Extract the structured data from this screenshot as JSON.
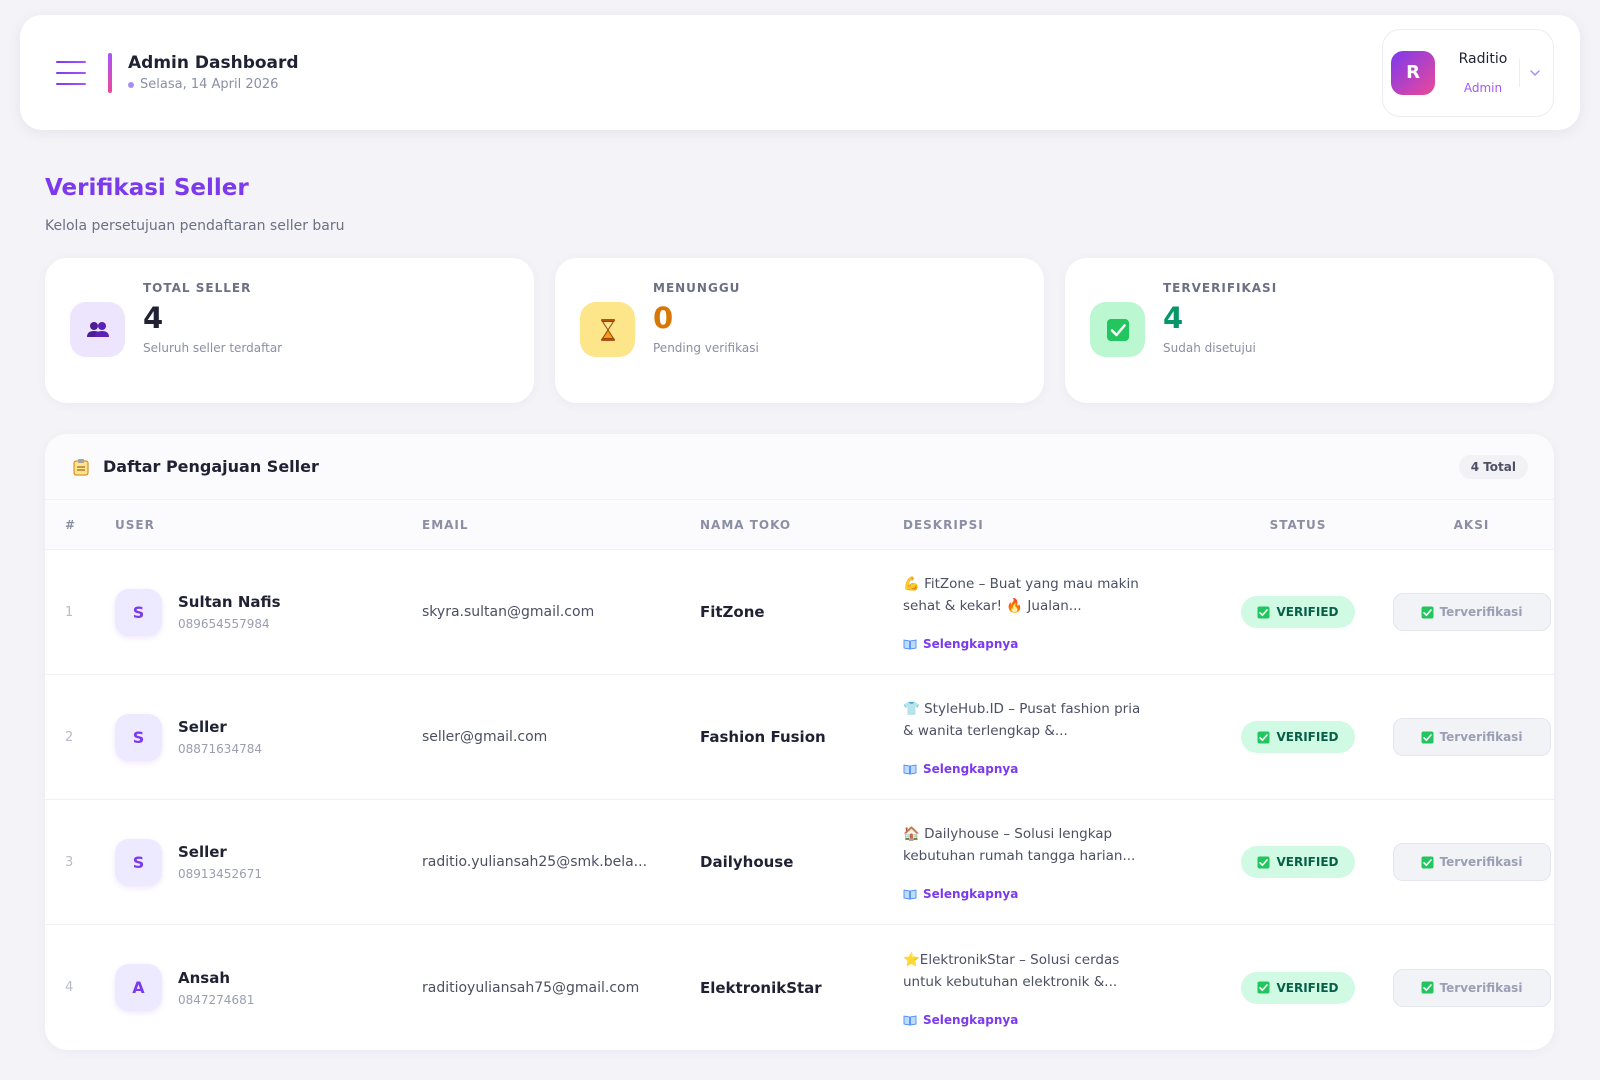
{
  "header": {
    "title": "Admin Dashboard",
    "date": "Selasa, 14 April 2026",
    "user": {
      "initial": "R",
      "name": "Raditio",
      "role": "Admin"
    }
  },
  "page": {
    "title": "Verifikasi Seller",
    "subtitle": "Kelola persetujuan pendaftaran seller baru"
  },
  "stats": [
    {
      "label": "TOTAL SELLER",
      "value": "4",
      "desc": "Seluruh seller terdaftar",
      "icon": "users-icon",
      "color": "#7c3aed"
    },
    {
      "label": "MENUNGGU",
      "value": "0",
      "desc": "Pending verifikasi",
      "icon": "hourglass-icon",
      "color": "#d97706"
    },
    {
      "label": "TERVERIFIKASI",
      "value": "4",
      "desc": "Sudah disetujui",
      "icon": "check-icon",
      "color": "#059669"
    }
  ],
  "table": {
    "title": "Daftar Pengajuan Seller",
    "total": "4 Total",
    "columns": {
      "num": "#",
      "user": "USER",
      "email": "EMAIL",
      "toko": "NAMA TOKO",
      "desc": "DESKRIPSI",
      "status": "STATUS",
      "aksi": "AKSI"
    },
    "more_label": "Selengkapnya",
    "rows": [
      {
        "num": "1",
        "initial": "S",
        "name": "Sultan Nafis",
        "phone": "089654557984",
        "email": "skyra.sultan@gmail.com",
        "toko": "FitZone",
        "desc": "💪 FitZone – Buat yang mau makin sehat & kekar! 🔥 Jualan...",
        "status": "VERIFIED",
        "aksi": "Terverifikasi"
      },
      {
        "num": "2",
        "initial": "S",
        "name": "Seller",
        "phone": "08871634784",
        "email": "seller@gmail.com",
        "toko": "Fashion Fusion",
        "desc": "👕 StyleHub.ID – Pusat fashion pria & wanita terlengkap &...",
        "status": "VERIFIED",
        "aksi": "Terverifikasi"
      },
      {
        "num": "3",
        "initial": "S",
        "name": "Seller",
        "phone": "08913452671",
        "email": "raditio.yuliansah25@smk.bela...",
        "toko": "Dailyhouse",
        "desc": "🏠 Dailyhouse – Solusi lengkap kebutuhan rumah tangga harian...",
        "status": "VERIFIED",
        "aksi": "Terverifikasi"
      },
      {
        "num": "4",
        "initial": "A",
        "name": "Ansah",
        "phone": "0847274681",
        "email": "raditioyuliansah75@gmail.com",
        "toko": "ElektronikStar",
        "desc": "⭐ElektronikStar – Solusi cerdas untuk kebutuhan elektronik &...",
        "status": "VERIFIED",
        "aksi": "Terverifikasi"
      }
    ]
  }
}
